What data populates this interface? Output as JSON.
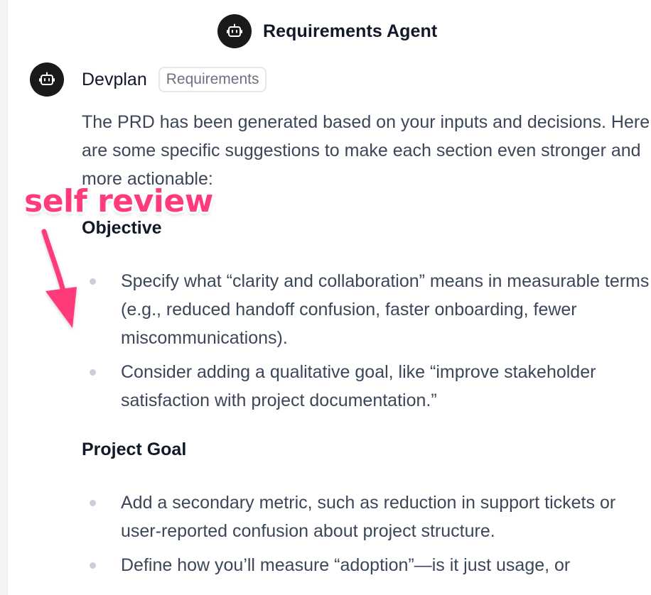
{
  "header": {
    "title": "Requirements Agent",
    "avatar_icon": "robot-icon"
  },
  "message": {
    "sender": "Devplan",
    "tag": "Requirements",
    "avatar_icon": "robot-icon",
    "intro": "The PRD has been generated based on your inputs and decisions. Here are some specific suggestions to make each section even stronger and more actionable:",
    "sections": [
      {
        "heading": "Objective",
        "bullets": [
          "Specify what “clarity and collaboration” means in measurable terms (e.g., reduced handoff confusion, faster onboarding, fewer miscommunications).",
          "Consider adding a qualitative goal, like “improve stakeholder satisfaction with project documentation.”"
        ]
      },
      {
        "heading": "Project Goal",
        "bullets": [
          "Add a secondary metric, such as reduction in support tickets or user-reported confusion about project structure.",
          "Define how you’ll measure “adoption”—is it just usage, or"
        ]
      }
    ]
  },
  "annotation": {
    "text": "self review",
    "color": "#ff3b7a"
  }
}
